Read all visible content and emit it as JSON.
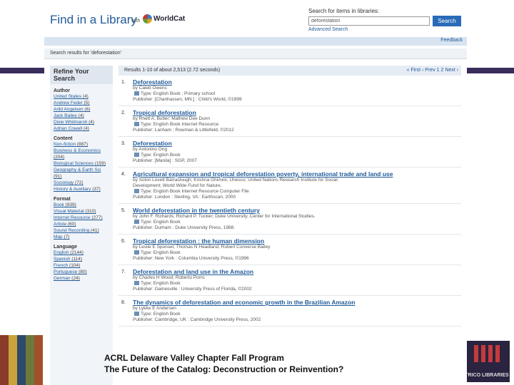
{
  "header": {
    "brand": "Find in a Library",
    "with_text": "with",
    "worldcat": "WorldCat",
    "search_label": "Search for items in libraries:",
    "search_value": "deforestation",
    "search_button": "Search",
    "advanced": "Advanced Search",
    "feedback": "Feedback"
  },
  "results_for": "Search results for 'deforestation'",
  "sidebar": {
    "title": "Refine Your Search",
    "sections": [
      {
        "head": "Author",
        "items": [
          {
            "label": "United States",
            "count": "(4)"
          },
          {
            "label": "Andrew Feder",
            "count": "(5)"
          },
          {
            "label": "Arild Angelsen",
            "count": "(6)"
          },
          {
            "label": "Jack Bailey",
            "count": "(4)"
          },
          {
            "label": "Dixie Whitmarsh",
            "count": "(4)"
          },
          {
            "label": "Adrian Cowell",
            "count": "(4)"
          }
        ]
      },
      {
        "head": "Content",
        "items": [
          {
            "label": "Non-fiction",
            "count": "(887)"
          },
          {
            "label": "Business & Economics",
            "count": "(204)"
          },
          {
            "label": "Biological Sciences",
            "count": "(159)"
          },
          {
            "label": "Geography & Earth Sci",
            "count": "(91)"
          },
          {
            "label": "Sociology",
            "count": "(72)"
          },
          {
            "label": "History & Auxiliary",
            "count": "(37)"
          }
        ]
      },
      {
        "head": "Format",
        "items": [
          {
            "label": "Book",
            "count": "(939)"
          },
          {
            "label": "Visual Material",
            "count": "(310)"
          },
          {
            "label": "Internet Resource",
            "count": "(277)"
          },
          {
            "label": "Article",
            "count": "(60)"
          },
          {
            "label": "Sound Recording",
            "count": "(41)"
          },
          {
            "label": "Map",
            "count": "(7)"
          }
        ]
      },
      {
        "head": "Language",
        "items": [
          {
            "label": "English",
            "count": "(2144)"
          },
          {
            "label": "Spanish",
            "count": "(114)"
          },
          {
            "label": "French",
            "count": "(104)"
          },
          {
            "label": "Portuguese",
            "count": "(80)"
          },
          {
            "label": "German",
            "count": "(24)"
          }
        ]
      }
    ]
  },
  "pager": {
    "count": "Results 1-10 of about 2,513 (2.72 seconds)",
    "nav": "« First ‹ Prev 1 2 Next ›"
  },
  "records": [
    {
      "num": "1.",
      "title": "Deforestation",
      "lines": [
        "by Caleb Owens",
        "Type: English Book : Primary school",
        "Publisher: [Chanhassen, MN.] : Child's World, ©1999"
      ]
    },
    {
      "num": "2.",
      "title": "Tropical deforestation",
      "lines": [
        "by Rhett A. Butler; Mathew Dee Dunn",
        "Type: English Book Internet Resource",
        "Publisher: Lanham : Rowman & Littlefield, ©2012"
      ]
    },
    {
      "num": "3.",
      "title": "Deforestation",
      "lines": [
        "by Antonino Ong",
        "Type: English Book",
        "Publisher: [Manila] : SGP, 2007"
      ]
    },
    {
      "num": "4.",
      "title": "Agricultural expansion and tropical deforestation poverty, international trade and land use",
      "lines": [
        "by Solon Lovett Barraclough; Krishna Ghimire; Unesco; United Nations Research Institute for Social",
        "Development; World Wide Fund for Nature.",
        "Type: English Book Internet Resource Computer File",
        "Publisher: London : Sterling, VA : Earthscan, 2000"
      ]
    },
    {
      "num": "5.",
      "title": "World deforestation in the twentieth century",
      "lines": [
        "by John F. Richards; Richard P. Tucker; Duke University. Center for International Studies.",
        "Type: English Book",
        "Publisher: Durham : Duke University Press, 1988."
      ]
    },
    {
      "num": "6.",
      "title": "Tropical deforestation : the human dimension",
      "lines": [
        "by Leslie E Sponsel; Thomas N Headland; Robert Converse Bailey",
        "Type: English Book",
        "Publisher: New York : Columbia University Press, ©1996"
      ]
    },
    {
      "num": "7.",
      "title": "Deforestation and land use in the Amazon",
      "lines": [
        "by Charles H Wood; Roberto Porro",
        "Type: English Book",
        "Publisher: Gainesville : University Press of Florida, ©2002"
      ]
    },
    {
      "num": "8.",
      "title": "The dynamics of deforestation and economic growth in the Brazilian Amazon",
      "lines": [
        "by Lykke E Andersen",
        "Type: English Book",
        "Publisher: Cambridge, UK : Cambridge University Press, 2002"
      ]
    }
  ],
  "caption": {
    "line1": "ACRL Delaware Valley Chapter Fall Program",
    "line2": "The Future of the Catalog: Deconstruction or Reinvention?"
  },
  "logo": {
    "text": "TRICO LIBRARIES"
  },
  "colors": {
    "purple": "#3a2d5c",
    "link": "#1f5a99",
    "button": "#2a6bb8"
  }
}
